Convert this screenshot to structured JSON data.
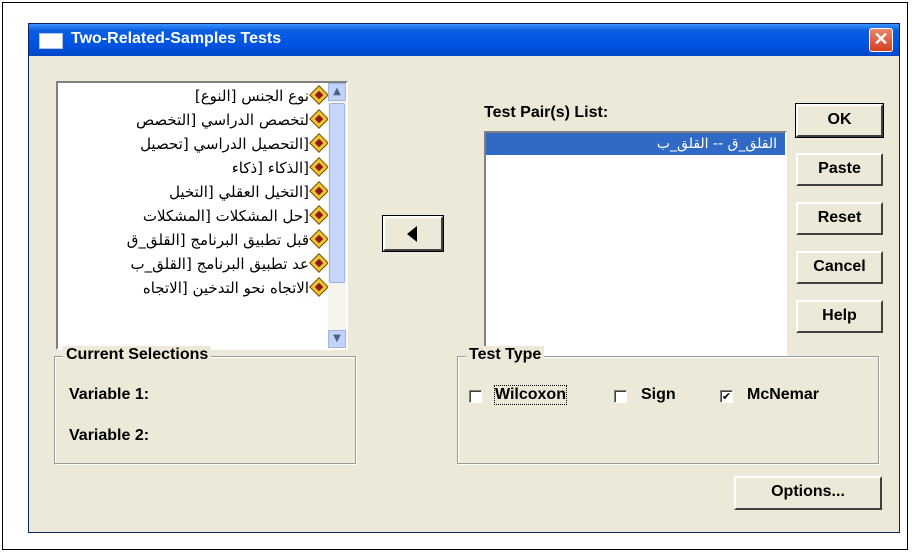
{
  "window": {
    "title": "Two-Related-Samples Tests",
    "close_glyph": "✕"
  },
  "variables": {
    "items": [
      "نوع الجنس [النوع]",
      "لتخصص الدراسي [التخصص",
      "[التحصيل الدراسي [تحصيل",
      "[الذكاء [ذكاء",
      "[التخيل العقلي [التخيل",
      "[حل المشكلات [المشكلات",
      "قبل تطبيق البرنامج [القلق_ق",
      "عد تطبيق البرنامج [القلق_ب",
      "الاتجاه نحو التدخين [الاتجاه"
    ],
    "icon": "nominal-variable-icon"
  },
  "transfer": {
    "icon": "left-arrow-icon"
  },
  "test_pairs": {
    "label": "Test Pair(s) List:",
    "items": [
      "القلق_ق -- القلق_ب"
    ]
  },
  "buttons": {
    "ok": "OK",
    "paste": "Paste",
    "reset": "Reset",
    "cancel": "Cancel",
    "help": "Help",
    "options": "Options..."
  },
  "current_selections": {
    "title": "Current Selections",
    "variable1_label": "Variable 1:",
    "variable2_label": "Variable 2:"
  },
  "test_type": {
    "title": "Test Type",
    "options": [
      {
        "label": "Wilcoxon",
        "checked": false
      },
      {
        "label": "Sign",
        "checked": false
      },
      {
        "label": "McNemar",
        "checked": true
      }
    ]
  },
  "colors": {
    "titlebar": "#0054e3",
    "selection": "#316ac5",
    "dialog_bg": "#ece9d8",
    "close_button": "#d1401f"
  }
}
